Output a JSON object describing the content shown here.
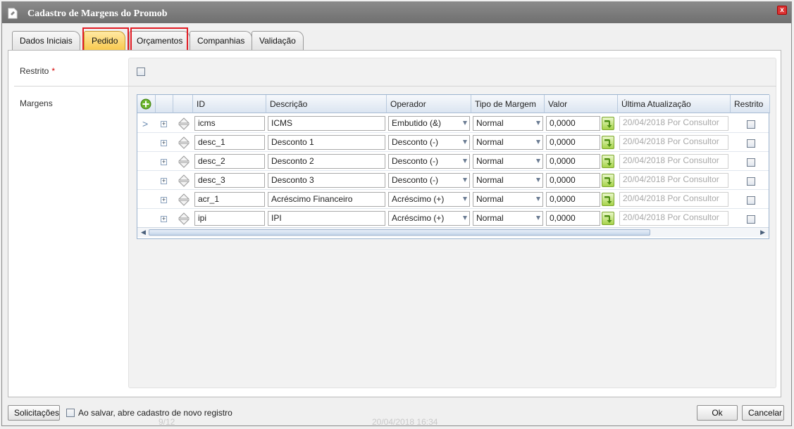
{
  "window": {
    "title": "Cadastro de Margens do Promob"
  },
  "tabs": [
    {
      "label": "Dados Iniciais"
    },
    {
      "label": "Pedido"
    },
    {
      "label": "Orçamentos"
    },
    {
      "label": "Companhias"
    },
    {
      "label": "Validação"
    }
  ],
  "active_tab": "Pedido",
  "form": {
    "restrito_label": "Restrito",
    "required_mark": "*",
    "margens_label": "Margens"
  },
  "grid": {
    "columns": [
      "ID",
      "Descrição",
      "Operador",
      "Tipo de Margem",
      "Valor",
      "Última Atualização",
      "Restrito"
    ],
    "rows": [
      {
        "id": "icms",
        "descricao": "ICMS",
        "operador": "Embutido (&)",
        "tipo": "Normal",
        "valor": "0,0000",
        "atualizacao": "20/04/2018 Por Consultor",
        "restrito": false,
        "current": true
      },
      {
        "id": "desc_1",
        "descricao": "Desconto 1",
        "operador": "Desconto (-)",
        "tipo": "Normal",
        "valor": "0,0000",
        "atualizacao": "20/04/2018 Por Consultor",
        "restrito": false,
        "current": false
      },
      {
        "id": "desc_2",
        "descricao": "Desconto 2",
        "operador": "Desconto (-)",
        "tipo": "Normal",
        "valor": "0,0000",
        "atualizacao": "20/04/2018 Por Consultor",
        "restrito": false,
        "current": false
      },
      {
        "id": "desc_3",
        "descricao": "Desconto 3",
        "operador": "Desconto (-)",
        "tipo": "Normal",
        "valor": "0,0000",
        "atualizacao": "20/04/2018 Por Consultor",
        "restrito": false,
        "current": false
      },
      {
        "id": "acr_1",
        "descricao": "Acréscimo Financeiro",
        "operador": "Acréscimo (+)",
        "tipo": "Normal",
        "valor": "0,0000",
        "atualizacao": "20/04/2018 Por Consultor",
        "restrito": false,
        "current": false
      },
      {
        "id": "ipi",
        "descricao": "IPI",
        "operador": "Acréscimo (+)",
        "tipo": "Normal",
        "valor": "0,0000",
        "atualizacao": "20/04/2018 Por Consultor",
        "restrito": false,
        "current": false
      }
    ]
  },
  "footer": {
    "solicitacoes_label": "Solicitações",
    "save_option_label": "Ao salvar, abre cadastro de novo registro",
    "ok_label": "Ok",
    "cancel_label": "Cancelar",
    "background_ghost_1": "20/04/2018 16:34",
    "background_ghost_2": "9/12"
  },
  "colors": {
    "highlight": "#e21c24",
    "active_tab": "#f8c94f",
    "titlebar": "#7a7a7a"
  }
}
